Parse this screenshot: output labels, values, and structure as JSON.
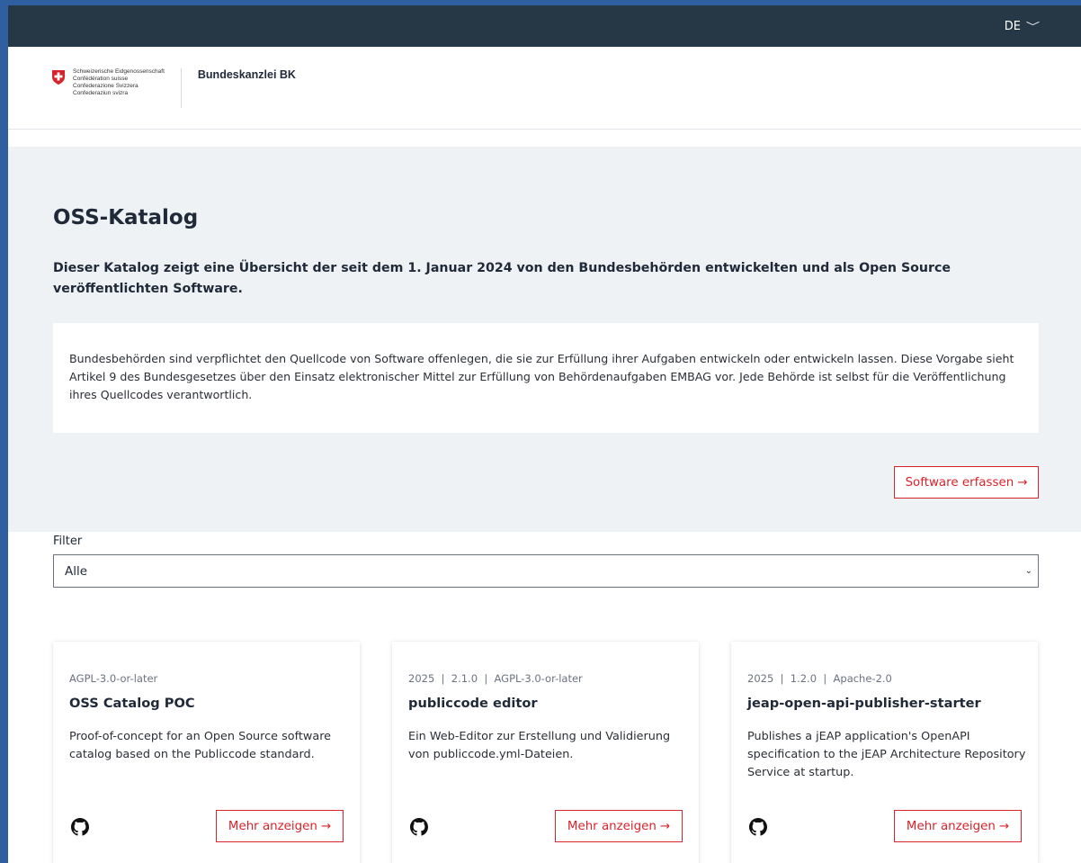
{
  "topbar": {
    "language": "DE"
  },
  "header": {
    "confederation_lines": [
      "Schweizerische Eidgenossenschaft",
      "Confédération suisse",
      "Confederazione Svizzera",
      "Confederaziun svizra"
    ],
    "department": "Bundeskanzlei BK"
  },
  "hero": {
    "title": "OSS-Katalog",
    "lead": "Dieser Katalog zeigt eine Übersicht der seit dem 1. Januar 2024 von den Bundesbehörden entwickelten und als Open Source veröffentlichten Software.",
    "info": "Bundesbehörden sind verpflichtet den Quellcode von Software offenlegen, die sie zur Erfüllung ihrer Aufgaben entwickeln oder entwickeln lassen. Diese Vorgabe sieht Artikel 9 des Bundesgesetzes über den Einsatz elektronischer Mittel zur Erfüllung von Behördenaufgaben EMBAG vor. Jede Behörde ist selbst für die Veröffentlichung ihres Quellcodes verantwortlich.",
    "register_label": "Software erfassen"
  },
  "filter": {
    "label": "Filter",
    "selected": "Alle"
  },
  "cards": [
    {
      "meta": "AGPL-3.0-or-later",
      "title": "OSS Catalog POC",
      "description": "Proof-of-concept for an Open Source software catalog based on the Publiccode standard.",
      "button": "Mehr anzeigen"
    },
    {
      "meta": "2025  |  2.1.0  |  AGPL-3.0-or-later",
      "title": "publiccode editor",
      "description": "Ein Web-Editor zur Erstellung und Validierung von publiccode.yml-Dateien.",
      "button": "Mehr anzeigen"
    },
    {
      "meta": "2025  |  1.2.0  |  Apache-2.0",
      "title": "jeap-open-api-publisher-starter",
      "description": "Publishes a jEAP application's OpenAPI specification to the jEAP Architecture Repository Service at startup.",
      "button": "Mehr anzeigen"
    }
  ],
  "icons": {
    "arrow": "arrow-right-icon",
    "repo": "github-icon",
    "flag": "swiss-flag-icon"
  },
  "colors": {
    "accent": "#d8232a",
    "topbar": "#263746",
    "hero_bg": "#eff2f5"
  }
}
